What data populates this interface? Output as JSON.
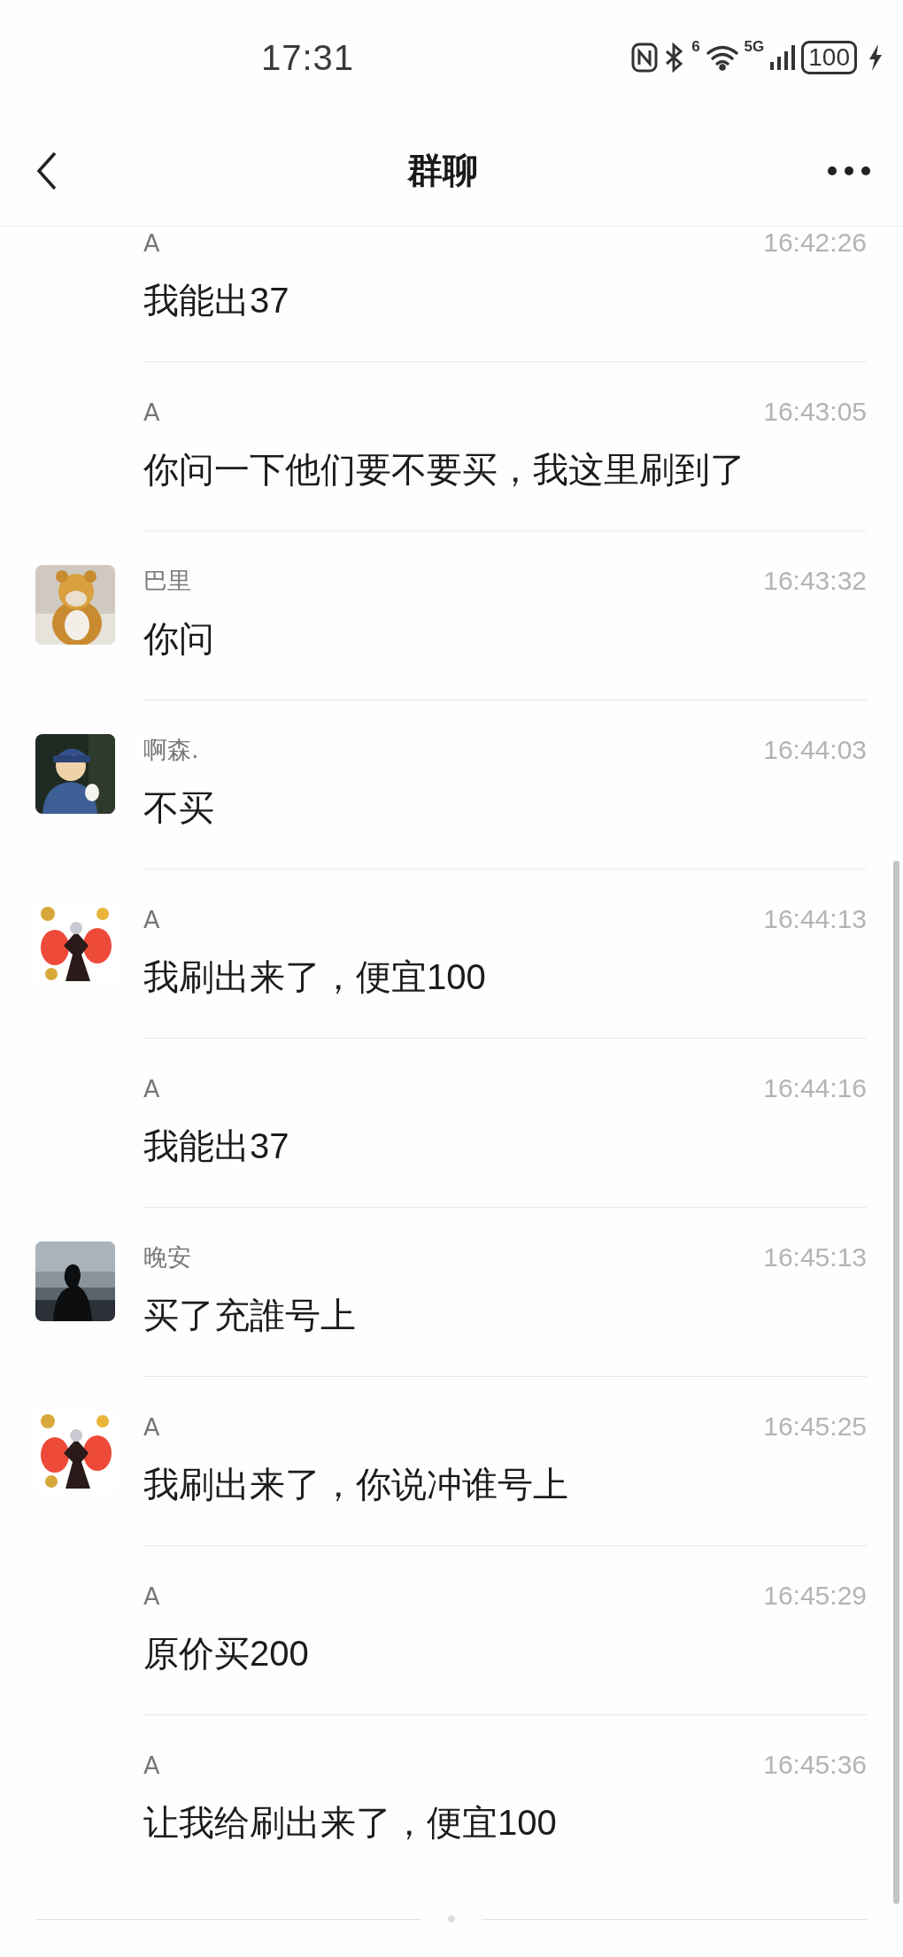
{
  "status_bar": {
    "time": "17:31",
    "wifi_badge": "6",
    "network": "5G",
    "battery": "100",
    "charging": true
  },
  "nav": {
    "title": "群聊"
  },
  "messages": [
    {
      "sender": "A",
      "time": "16:42:26",
      "text": "我能出37"
    },
    {
      "sender": "A",
      "time": "16:43:05",
      "text": "你问一下他们要不要买，我这里刷到了"
    },
    {
      "sender": "巴里",
      "time": "16:43:32",
      "text": "你问"
    },
    {
      "sender": "啊森.",
      "time": "16:44:03",
      "text": "不买"
    },
    {
      "sender": "A",
      "time": "16:44:13",
      "text": "我刷出来了，便宜100"
    },
    {
      "sender": "A",
      "time": "16:44:16",
      "text": "我能出37"
    },
    {
      "sender": "晚安",
      "time": "16:45:13",
      "text": "买了充誰号上"
    },
    {
      "sender": "A",
      "time": "16:45:25",
      "text": "我刷出来了，你说冲谁号上"
    },
    {
      "sender": "A",
      "time": "16:45:29",
      "text": "原价买200"
    },
    {
      "sender": "A",
      "time": "16:45:36",
      "text": "让我给刷出来了，便宜100"
    }
  ]
}
